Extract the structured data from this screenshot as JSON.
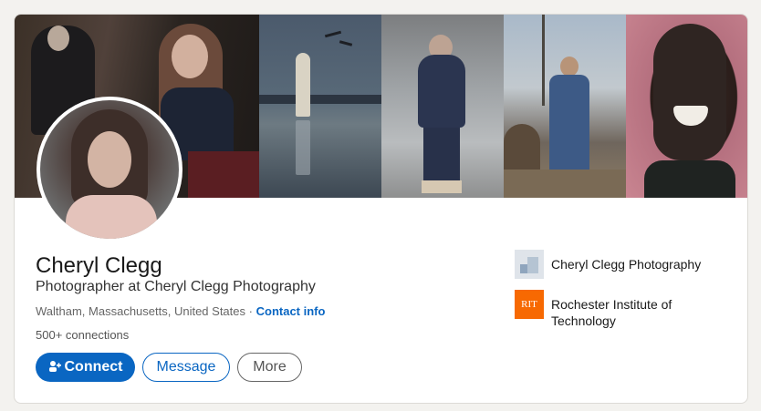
{
  "profile": {
    "name": "Cheryl Clegg",
    "headline": "Photographer at Cheryl Clegg Photography",
    "location": "Waltham, Massachusetts, United States",
    "location_separator": "·",
    "contact_info_label": "Contact info",
    "connections": "500+ connections"
  },
  "actions": {
    "connect_label": "Connect",
    "connect_icon": "add-person-icon",
    "message_label": "Message",
    "more_label": "More"
  },
  "orgs": [
    {
      "name": "Cheryl Clegg Photography",
      "logo": "company-logo-icon"
    },
    {
      "name": "Rochester Institute of Technology",
      "logo_text": "RIT"
    }
  ],
  "colors": {
    "primary": "#0a66c2",
    "rit_orange": "#f76902",
    "background": "#f3f2ef"
  }
}
